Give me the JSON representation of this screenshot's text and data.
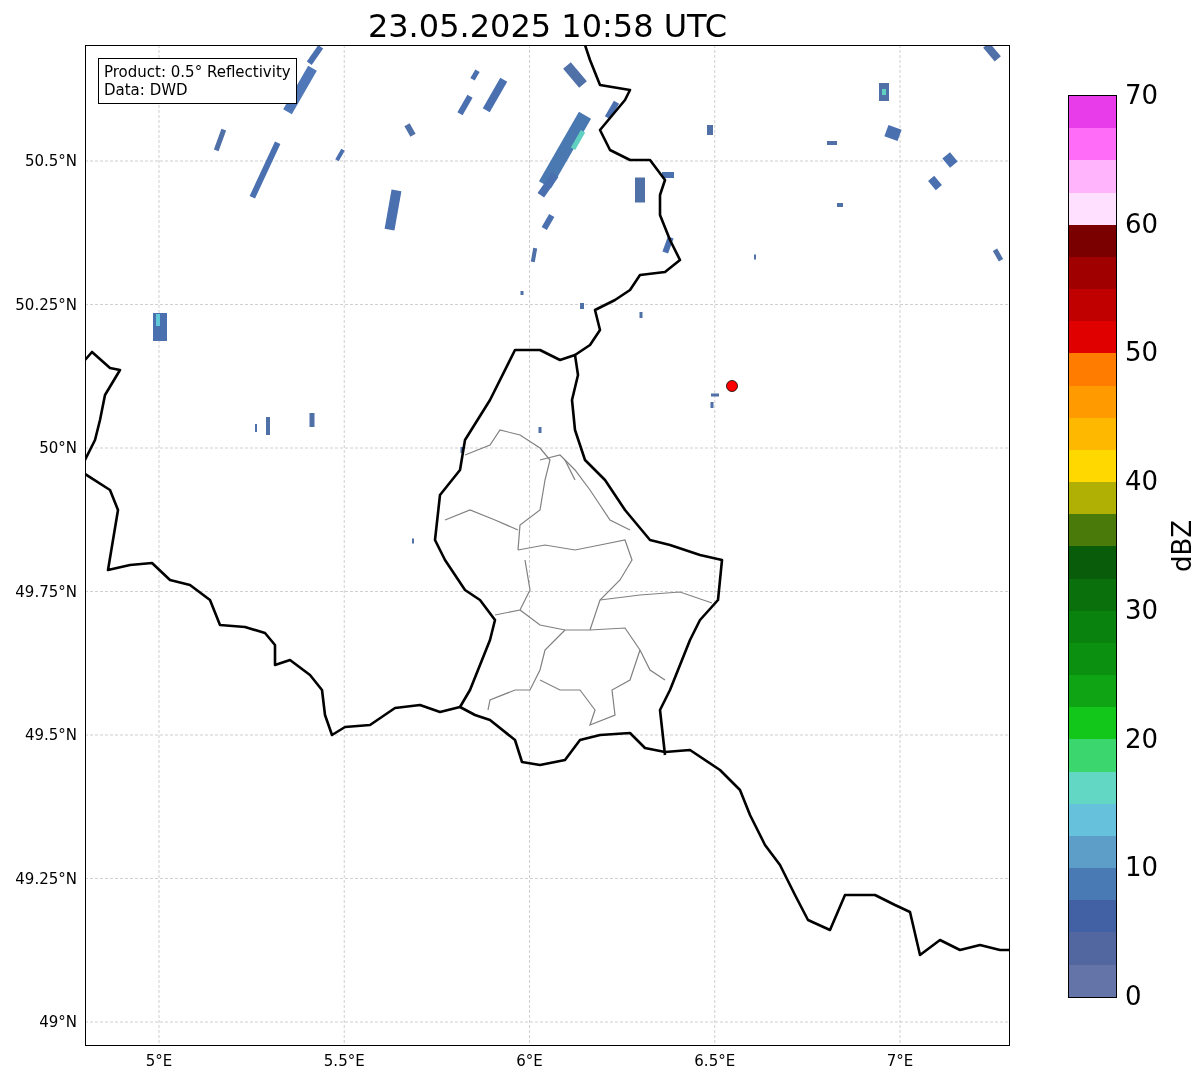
{
  "title": "23.05.2025 10:58 UTC",
  "legend": {
    "lines": [
      "Product: 0.5° Reflectivity",
      "Data: DWD"
    ]
  },
  "map": {
    "lat_labels": [
      "50.5°N",
      "50.25°N",
      "50°N",
      "49.75°N",
      "49.5°N",
      "49.25°N",
      "49°N"
    ],
    "lon_labels": [
      "5°E",
      "5.5°E",
      "6°E",
      "6.5°E",
      "7°E"
    ],
    "station": {
      "color": "#ff0000"
    }
  },
  "colorbar": {
    "label": "dBZ",
    "ticks": [
      "70",
      "60",
      "50",
      "40",
      "30",
      "20",
      "10",
      "0"
    ],
    "bins": [
      {
        "color": "#e83cea"
      },
      {
        "color": "#ff6cf8"
      },
      {
        "color": "#ffb4fc"
      },
      {
        "color": "#ffe0fe"
      },
      {
        "color": "#7a0000"
      },
      {
        "color": "#a00000"
      },
      {
        "color": "#c00000"
      },
      {
        "color": "#e00000"
      },
      {
        "color": "#ff7c00"
      },
      {
        "color": "#ff9a00"
      },
      {
        "color": "#ffb800"
      },
      {
        "color": "#ffd800"
      },
      {
        "color": "#b0b004"
      },
      {
        "color": "#4a7a0a"
      },
      {
        "color": "#085c0a"
      },
      {
        "color": "#0a700c"
      },
      {
        "color": "#0a820e"
      },
      {
        "color": "#0c9010"
      },
      {
        "color": "#0ea414"
      },
      {
        "color": "#12c61a"
      },
      {
        "color": "#3cd66e"
      },
      {
        "color": "#62d8c4"
      },
      {
        "color": "#66c2dc"
      },
      {
        "color": "#5c9ec8"
      },
      {
        "color": "#4a7ab4"
      },
      {
        "color": "#4260a4"
      },
      {
        "color": "#5266a0"
      },
      {
        "color": "#6474a8"
      }
    ]
  }
}
